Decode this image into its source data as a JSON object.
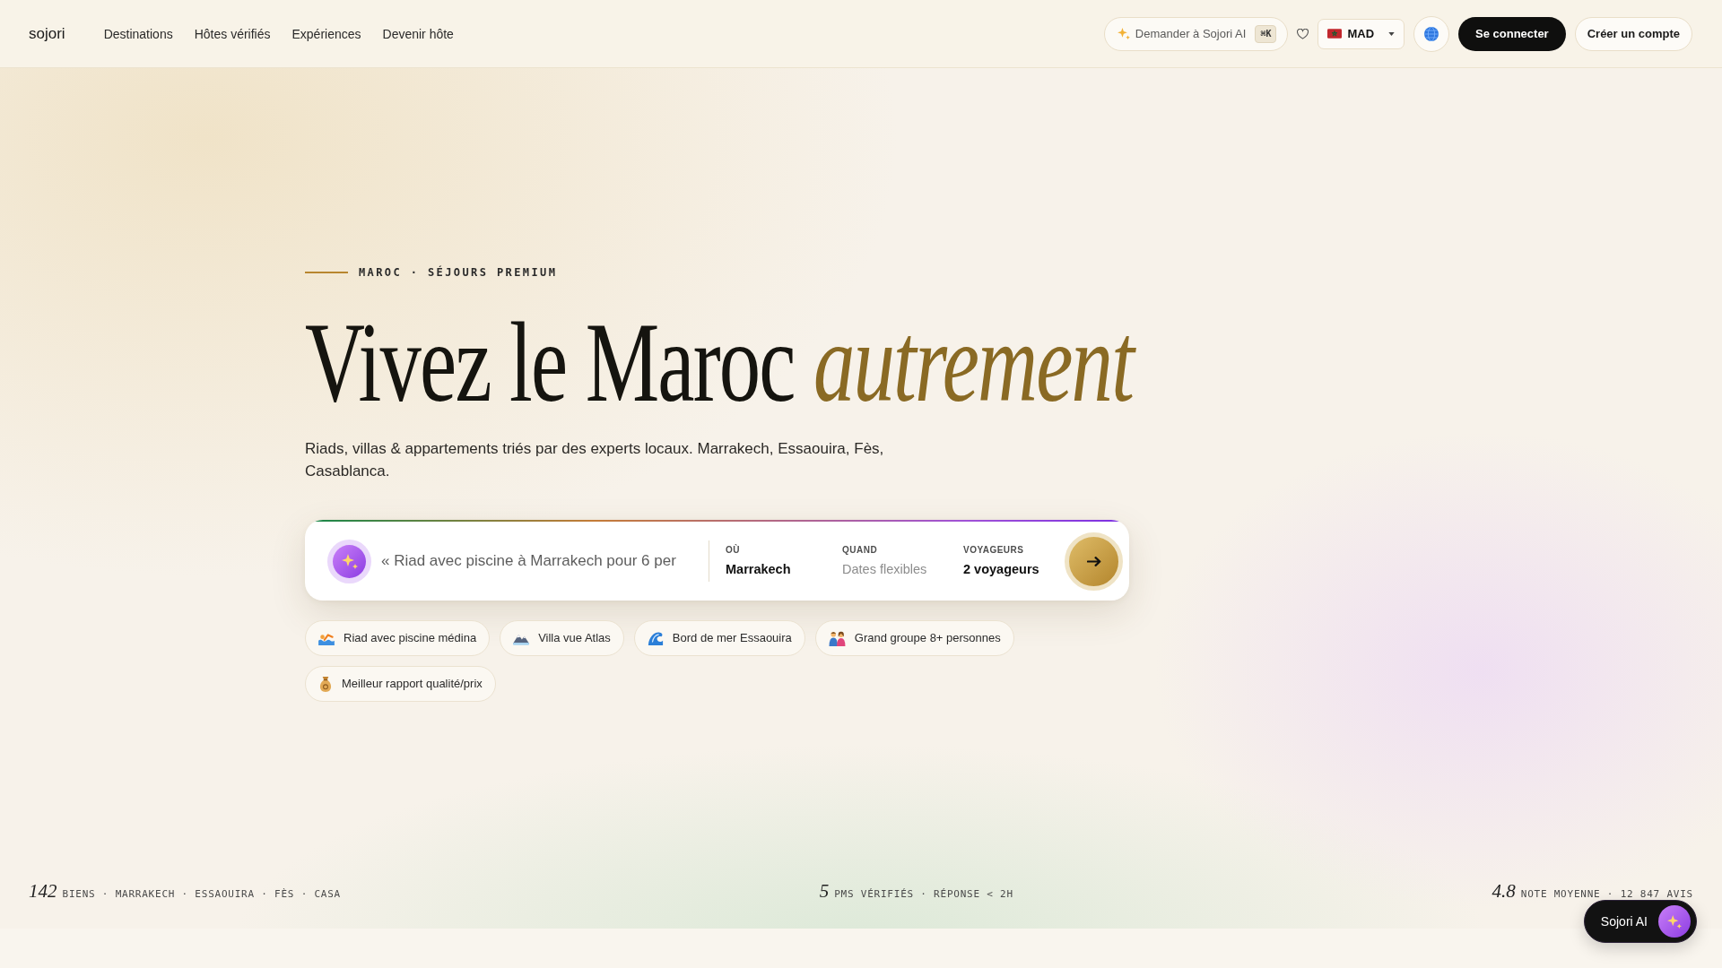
{
  "nav": {
    "logo": "sojori",
    "links": [
      "Destinations",
      "Hôtes vérifiés",
      "Expériences",
      "Devenir hôte"
    ],
    "ask_ai": {
      "label": "Demander à Sojori AI",
      "shortcut": "⌘K"
    },
    "currency": "MAD",
    "sign_in": "Se connecter",
    "sign_up": "Créer un compte"
  },
  "hero": {
    "eyebrow": "MAROC · SÉJOURS PREMIUM",
    "title": "Vivez le Maroc *autrement*",
    "subtitle": "Riads, villas & appartements triés par des experts locaux. Marrakech, Essaouira, Fès, Casablanca.",
    "search": {
      "query": {
        "placeholder": "« Riad avec piscine à Marrakech pour 6 per"
      },
      "fields": [
        {
          "label": "OÙ",
          "value": "Marrakech"
        },
        {
          "label": "QUAND",
          "placeholder": "Dates flexibles"
        },
        {
          "label": "VOYAGEURS",
          "value": "2 voyageurs"
        }
      ]
    },
    "suggestions": [
      "Riad avec piscine médina",
      "Villa vue Atlas",
      "Bord de mer Essaouira",
      "Grand groupe 8+ personnes",
      "Meilleur rapport qualité/prix"
    ]
  },
  "stats": [
    {
      "value": "142",
      "label": "BIENS · MARRAKECH · ESSAOUIRA · FÈS · CASA"
    },
    {
      "value": "5",
      "label": "PMS VÉRIFIÉS · RÉPONSE < 2H"
    },
    {
      "value": "4.8",
      "label": "NOTE MOYENNE · 12 847 AVIS"
    }
  ],
  "assistant": {
    "label": "Sojori AI"
  }
}
